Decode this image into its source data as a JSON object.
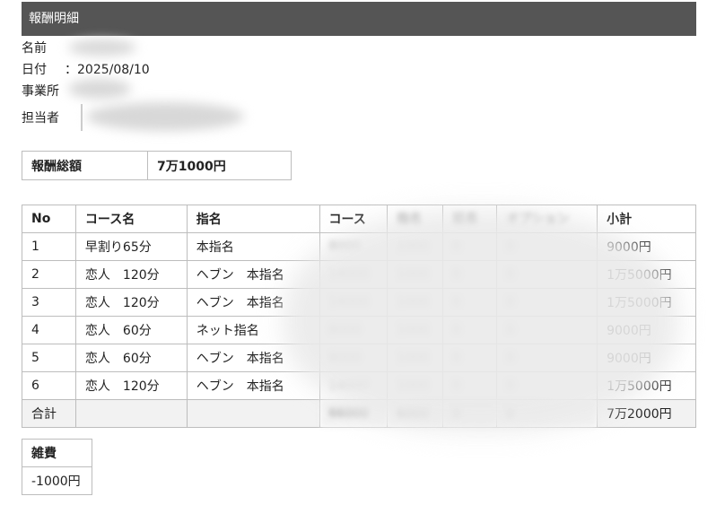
{
  "header": {
    "title": "報酬明細"
  },
  "info": {
    "name_label": "名前",
    "date_label": "日付",
    "date_value": "：2025/08/10",
    "office_label": "事業所",
    "staff_label": "担当者"
  },
  "total": {
    "label": "報酬総額",
    "value": "7万1000円"
  },
  "table": {
    "headers": [
      "No",
      "コース名",
      "指名",
      "コース",
      "指名",
      "延長",
      "オプション",
      "小計"
    ],
    "rows": [
      [
        "1",
        "早割り65分",
        "本指名",
        "8000",
        "1000",
        "0",
        "0",
        "9000円"
      ],
      [
        "2",
        "恋人　120分",
        "ヘブン　本指名",
        "14000",
        "1000",
        "0",
        "0",
        "1万5000円"
      ],
      [
        "3",
        "恋人　120分",
        "ヘブン　本指名",
        "14000",
        "1000",
        "0",
        "0",
        "1万5000円"
      ],
      [
        "4",
        "恋人　60分",
        "ネット指名",
        "8000",
        "1000",
        "0",
        "0",
        "9000円"
      ],
      [
        "5",
        "恋人　60分",
        "ヘブン　本指名",
        "8000",
        "1000",
        "0",
        "0",
        "9000円"
      ],
      [
        "6",
        "恋人　120分",
        "ヘブン　本指名",
        "14000",
        "1000",
        "0",
        "0",
        "1万5000円"
      ]
    ],
    "sum_label": "合計",
    "sum": [
      "66000",
      "6000",
      "0",
      "0",
      "7万2000円"
    ]
  },
  "misc": {
    "label": "雑費",
    "value": "-1000円"
  }
}
